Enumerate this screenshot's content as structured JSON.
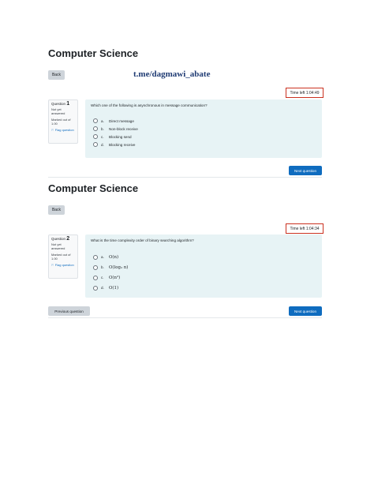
{
  "page": {
    "title": "Computer Science",
    "back_label": "Back",
    "watermark": "t.me/dagmawi_abate"
  },
  "q1": {
    "timer": "Time left 1:04:49",
    "info": {
      "question_label": "Question ",
      "question_number": "1",
      "status_line1": "Not yet",
      "status_line2": "answered",
      "marked_line1": "Marked out of",
      "marked_line2": "1.00",
      "flag_label": "Flag question"
    },
    "text": "Which one of the following is asynchronous in message communication?",
    "options": [
      {
        "letter": "a.",
        "text": "Direct message"
      },
      {
        "letter": "b.",
        "text": "Non-block receive"
      },
      {
        "letter": "c.",
        "text": "Blocking send"
      },
      {
        "letter": "d.",
        "text": "Blocking receive"
      }
    ],
    "next_label": "Next question"
  },
  "q2": {
    "title": "Computer Science",
    "back_label": "Back",
    "timer": "Time left 1:04:34",
    "info": {
      "question_label": "Question ",
      "question_number": "2",
      "status_line1": "Not yet",
      "status_line2": "answered",
      "marked_line1": "Marked out of",
      "marked_line2": "1.00",
      "flag_label": "Flag question"
    },
    "text": "What is the time complexity order of binary searching algorithm?",
    "options": [
      {
        "letter": "a.",
        "text": "O(n)"
      },
      {
        "letter": "b.",
        "text": "O(log₂ n)"
      },
      {
        "letter": "c.",
        "text": "O(n²)"
      },
      {
        "letter": "d.",
        "text": "O(1)"
      }
    ],
    "prev_label": "Previous question",
    "next_label": "Next question"
  },
  "icons": {
    "flag": "flag-icon",
    "radio": "radio-button"
  }
}
